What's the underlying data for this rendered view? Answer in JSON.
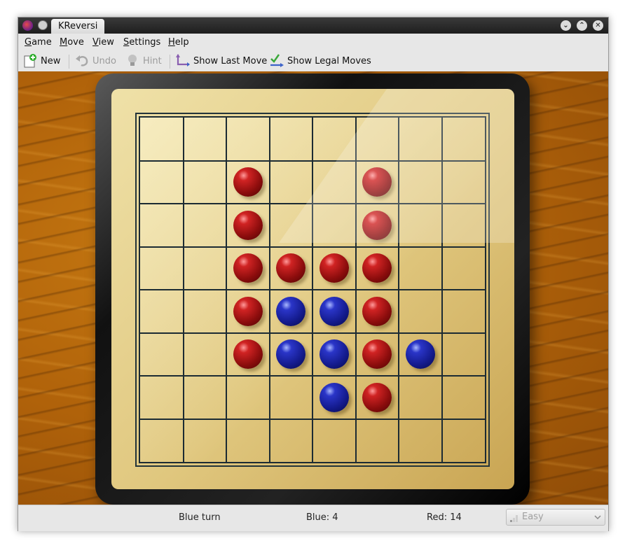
{
  "window": {
    "title": "KReversi",
    "icons": {
      "app": "kreversi-app-icon",
      "menu": "window-menu-icon",
      "minimize": "minimize-icon",
      "maximize": "maximize-icon",
      "close": "close-icon"
    }
  },
  "menu": {
    "items": [
      {
        "label": "Game",
        "mnemonic": "G",
        "rest": "ame"
      },
      {
        "label": "Move",
        "mnemonic": "M",
        "rest": "ove"
      },
      {
        "label": "View",
        "mnemonic": "V",
        "rest": "iew"
      },
      {
        "label": "Settings",
        "mnemonic": "S",
        "rest": "ettings"
      },
      {
        "label": "Help",
        "mnemonic": "H",
        "rest": "elp"
      }
    ]
  },
  "toolbar": {
    "new_label": "New",
    "undo_label": "Undo",
    "hint_label": "Hint",
    "show_last_move_label": "Show Last Move",
    "show_legal_moves_label": "Show Legal Moves"
  },
  "board": {
    "size": 8,
    "pieces": [
      {
        "row": 1,
        "col": 2,
        "color": "red"
      },
      {
        "row": 1,
        "col": 5,
        "color": "red"
      },
      {
        "row": 2,
        "col": 2,
        "color": "red"
      },
      {
        "row": 2,
        "col": 5,
        "color": "red"
      },
      {
        "row": 3,
        "col": 2,
        "color": "red"
      },
      {
        "row": 3,
        "col": 3,
        "color": "red"
      },
      {
        "row": 3,
        "col": 4,
        "color": "red"
      },
      {
        "row": 3,
        "col": 5,
        "color": "red"
      },
      {
        "row": 4,
        "col": 2,
        "color": "red"
      },
      {
        "row": 4,
        "col": 3,
        "color": "blue"
      },
      {
        "row": 4,
        "col": 4,
        "color": "blue"
      },
      {
        "row": 4,
        "col": 5,
        "color": "red"
      },
      {
        "row": 5,
        "col": 2,
        "color": "red"
      },
      {
        "row": 5,
        "col": 3,
        "color": "blue"
      },
      {
        "row": 5,
        "col": 4,
        "color": "blue"
      },
      {
        "row": 5,
        "col": 5,
        "color": "red"
      },
      {
        "row": 5,
        "col": 6,
        "color": "blue"
      },
      {
        "row": 6,
        "col": 4,
        "color": "blue"
      },
      {
        "row": 6,
        "col": 5,
        "color": "red"
      }
    ],
    "colors": {
      "red": "#b01818",
      "blue": "#1c25a8",
      "board": "#e6cf88",
      "wood": "#b5660b"
    }
  },
  "status": {
    "turn": "Blue turn",
    "blue_score": "Blue: 4",
    "red_score": "Red: 14",
    "difficulty": "Easy"
  }
}
